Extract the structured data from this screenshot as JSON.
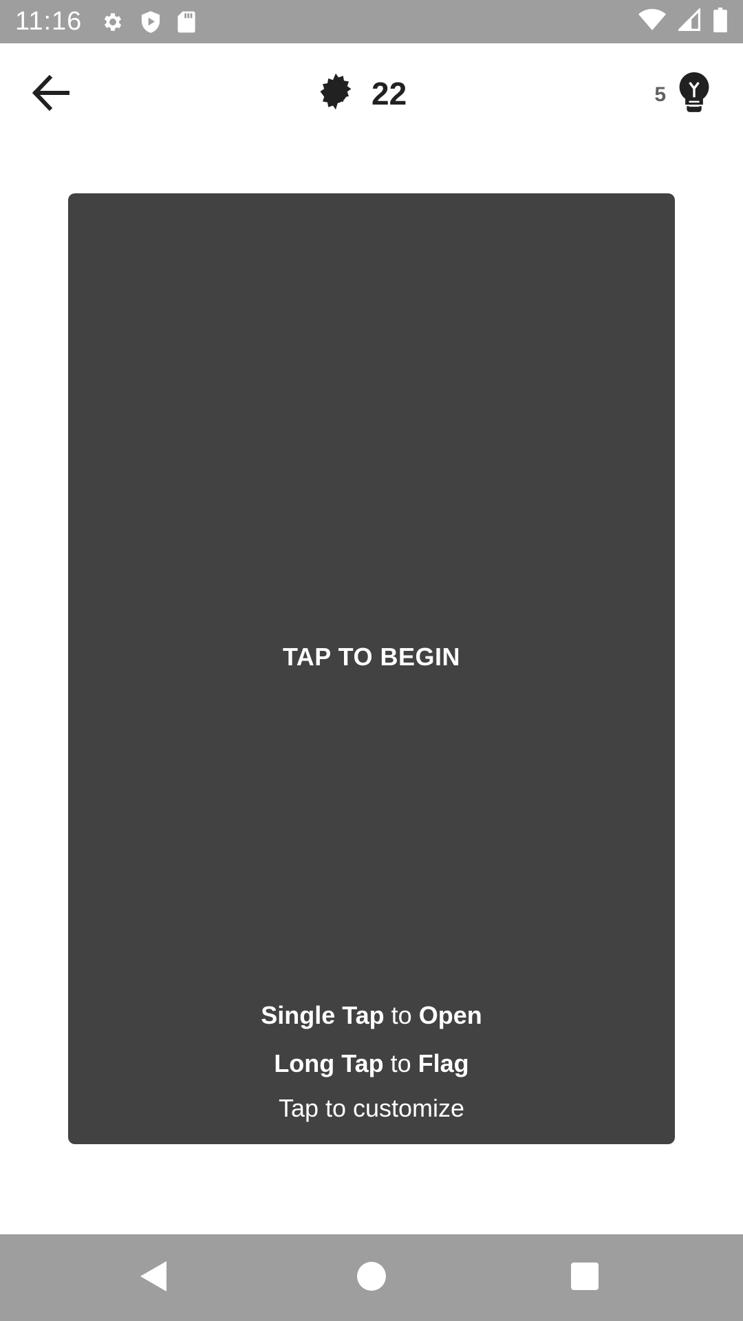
{
  "status_bar": {
    "time": "11:16",
    "icons": [
      "gear-icon",
      "shield-play-icon",
      "sd-card-icon"
    ],
    "right_icons": [
      "wifi-icon",
      "signal-icon",
      "battery-icon"
    ],
    "background": "#9e9e9e"
  },
  "app_bar": {
    "back_icon": "arrow-left-icon",
    "mine_icon": "mine-icon",
    "mine_count": "22",
    "hints_count": "5",
    "hint_icon": "lightbulb-icon"
  },
  "board": {
    "background": "#424242",
    "start_prompt": "TAP TO BEGIN",
    "instruction_1": {
      "action": "Single Tap",
      "connector": "to",
      "result": "Open"
    },
    "instruction_2": {
      "action": "Long Tap",
      "connector": "to",
      "result": "Flag"
    },
    "customize_label": "Tap to customize"
  },
  "nav_bar": {
    "buttons": [
      "back-triangle-icon",
      "home-circle-icon",
      "recents-square-icon"
    ],
    "background": "#9e9e9e"
  }
}
